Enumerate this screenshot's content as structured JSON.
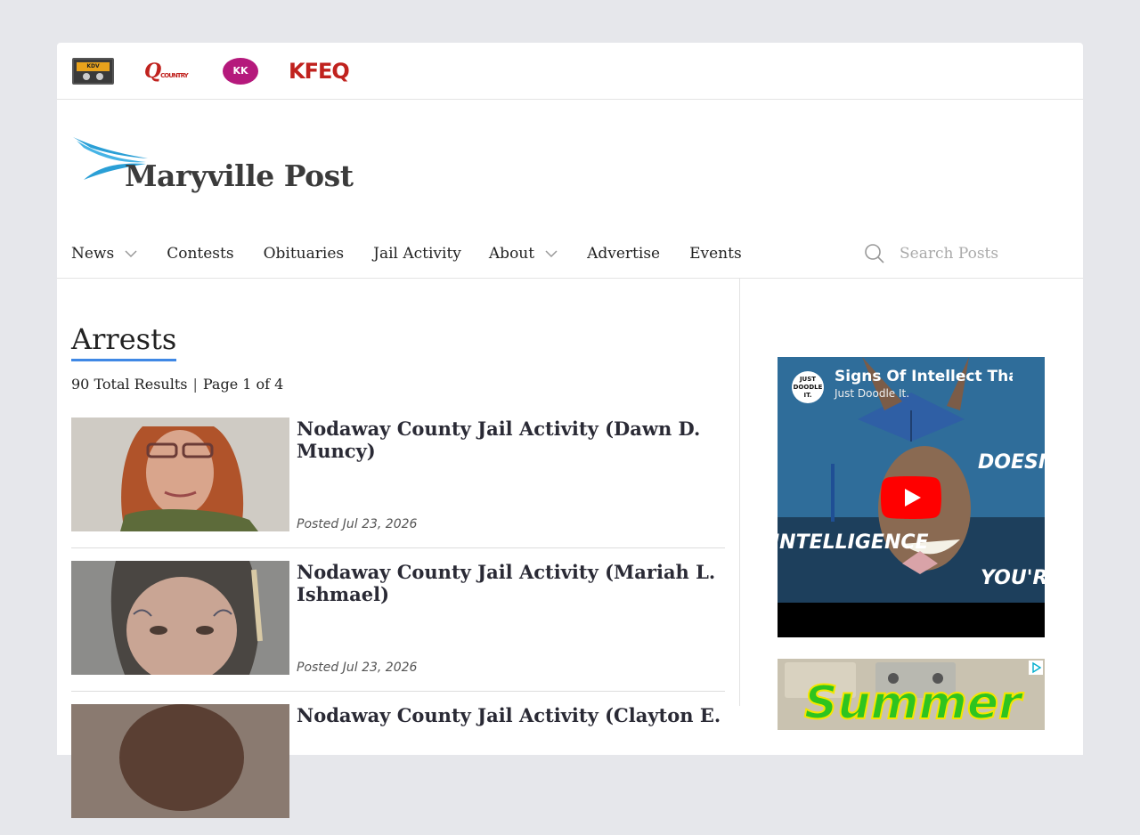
{
  "stations": [
    {
      "name": "cassette-station",
      "label": "KDV"
    },
    {
      "name": "q-country",
      "label": "Q",
      "sub": "COUNTRY"
    },
    {
      "name": "kk-station",
      "label": "KK"
    },
    {
      "name": "kfeq",
      "label": "KFEQ"
    }
  ],
  "site": {
    "name": "Maryville Post"
  },
  "nav": {
    "items": [
      {
        "label": "News",
        "dropdown": true
      },
      {
        "label": "Contests"
      },
      {
        "label": "Obituaries"
      },
      {
        "label": "Jail Activity"
      },
      {
        "label": "About",
        "dropdown": true
      },
      {
        "label": "Advertise"
      },
      {
        "label": "Events"
      }
    ],
    "search_placeholder": "Search Posts"
  },
  "archive": {
    "title": "Arrests",
    "total": "90 Total Results",
    "page": "Page 1 of 4"
  },
  "posts": [
    {
      "title": "Nodaway County Jail Activity (Dawn D. Muncy)",
      "date": "Posted Jul 23, 2026"
    },
    {
      "title": "Nodaway County Jail Activity (Mariah L. Ishmael)",
      "date": "Posted Jul 23, 2026"
    },
    {
      "title": "Nodaway County Jail Activity (Clayton E.",
      "date": ""
    }
  ],
  "video": {
    "title": "Signs Of Intellect That Do",
    "channel": "Just Doodle It.",
    "avatar": "JUST DOODLE IT."
  },
  "ad": {
    "text": "Summer"
  },
  "colors": {
    "accent": "#3f88e5",
    "logo_blue": "#2a9fd6",
    "youtube_red": "#ff0000"
  }
}
